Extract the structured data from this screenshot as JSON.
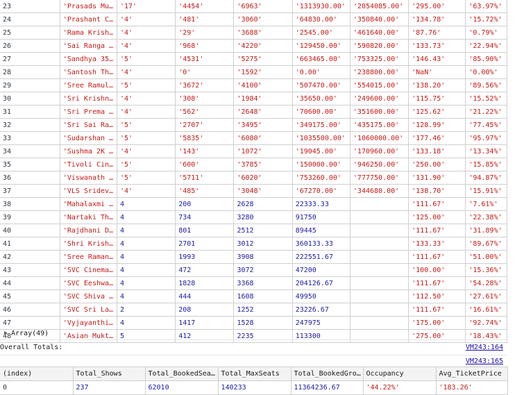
{
  "top_rows": [
    [
      "23",
      "'Prasads Mu…",
      "'17'",
      "'4454'",
      "'6963'",
      "'1313930.00'",
      "'2054085.00'",
      "'295.00'",
      "'63.97%'"
    ],
    [
      "24",
      "'Prashant C…",
      "'4'",
      "'481'",
      "'3060'",
      "'64830.00'",
      "'350840.00'",
      "'134.78'",
      "'15.72%'"
    ],
    [
      "25",
      "'Rama Krish…",
      "'4'",
      "'29'",
      "'3688'",
      "'2545.00'",
      "'461640.00'",
      "'87.76'",
      "'0.79%'"
    ],
    [
      "26",
      "'Sai Ranga …",
      "'4'",
      "'968'",
      "'4220'",
      "'129450.00'",
      "'590820.00'",
      "'133.73'",
      "'22.94%'"
    ],
    [
      "27",
      "'Sandhya 35…",
      "'5'",
      "'4531'",
      "'5275'",
      "'663465.00'",
      "'753325.00'",
      "'146.43'",
      "'85.90%'"
    ],
    [
      "28",
      "'Santosh Th…",
      "'4'",
      "'0'",
      "'1592'",
      "'0.00'",
      "'238800.00'",
      "'NaN'",
      "'0.00%'"
    ],
    [
      "29",
      "'Sree Ramul…",
      "'5'",
      "'3672'",
      "'4100'",
      "'507470.00'",
      "'554015.00'",
      "'138.20'",
      "'89.56%'"
    ],
    [
      "30",
      "'Sri Krishn…",
      "'4'",
      "'308'",
      "'1984'",
      "'35650.00'",
      "'249600.00'",
      "'115.75'",
      "'15.52%'"
    ],
    [
      "31",
      "'Sri Prema …",
      "'4'",
      "'562'",
      "'2648'",
      "'70600.00'",
      "'351600.00'",
      "'125.62'",
      "'21.22%'"
    ],
    [
      "32",
      "'Sri Sai Ra…",
      "'5'",
      "'2707'",
      "'3495'",
      "'349175.00'",
      "'435175.00'",
      "'128.99'",
      "'77.45%'"
    ],
    [
      "33",
      "'Sudarshan …",
      "'5'",
      "'5835'",
      "'6080'",
      "'1035500.00'",
      "'1060000.00'",
      "'177.46'",
      "'95.97%'"
    ],
    [
      "34",
      "'Sushma 2K …",
      "'4'",
      "'143'",
      "'1072'",
      "'19045.00'",
      "'170960.00'",
      "'133.18'",
      "'13.34%'"
    ],
    [
      "35",
      "'Tivoli Cin…",
      "'5'",
      "'600'",
      "'3785'",
      "'150000.00'",
      "'946250.00'",
      "'250.00'",
      "'15.85%'"
    ],
    [
      "36",
      "'Viswanath …",
      "'5'",
      "'5711'",
      "'6020'",
      "'753260.00'",
      "'777750.00'",
      "'131.90'",
      "'94.87%'"
    ],
    [
      "37",
      "'VLS Sridev…",
      "'4'",
      "'485'",
      "'3048'",
      "'67270.00'",
      "'344680.00'",
      "'138.70'",
      "'15.91%'"
    ],
    [
      "38",
      "'Mahalaxmi …",
      "4",
      "200",
      "2628",
      "22333.33",
      "",
      "'111.67'",
      "'7.61%'"
    ],
    [
      "39",
      "'Nartaki Th…",
      "4",
      "734",
      "3280",
      "91750",
      "",
      "'125.00'",
      "'22.38%'"
    ],
    [
      "40",
      "'Rajdhani D…",
      "4",
      "801",
      "2512",
      "89445",
      "",
      "'111.67'",
      "'31.89%'"
    ],
    [
      "41",
      "'Shri Krish…",
      "4",
      "2701",
      "3012",
      "360133.33",
      "",
      "'133.33'",
      "'89.67%'"
    ],
    [
      "42",
      "'Sree Raman…",
      "4",
      "1993",
      "3908",
      "222551.67",
      "",
      "'111.67'",
      "'51.00%'"
    ],
    [
      "43",
      "'SVC Cinema…",
      "4",
      "472",
      "3072",
      "47200",
      "",
      "'100.00'",
      "'15.36%'"
    ],
    [
      "44",
      "'SVC Eeshwa…",
      "4",
      "1828",
      "3368",
      "204126.67",
      "",
      "'111.67'",
      "'54.28%'"
    ],
    [
      "45",
      "'SVC Shiva …",
      "4",
      "444",
      "1608",
      "49950",
      "",
      "'112.50'",
      "'27.61%'"
    ],
    [
      "46",
      "'SVC Sri La…",
      "2",
      "208",
      "1252",
      "23226.67",
      "",
      "'111.67'",
      "'16.61%'"
    ],
    [
      "47",
      "'Vyjayanthi…",
      "4",
      "1417",
      "1528",
      "247975",
      "",
      "'175.00'",
      "'92.74%'"
    ],
    [
      "48",
      "'Asian Mukt…",
      "5",
      "412",
      "2235",
      "113300",
      "",
      "'275.00'",
      "'18.43%'"
    ]
  ],
  "array_label": "Array(49)",
  "totals_label": "Overall Totals:",
  "source_link_1": "VM243:164",
  "source_link_2": "VM243:165",
  "totals_table": {
    "headers": [
      "(index)",
      "Total_Shows",
      "Total_BookedSea…",
      "Total_MaxSeats",
      "Total_BookedGro…",
      "Occupancy",
      "Avg_TicketPrice"
    ],
    "row": [
      "0",
      "237",
      "62010",
      "140233",
      "11364236.67",
      "'44.22%'",
      "'183.26'"
    ]
  },
  "colors": {
    "string": "#c41a16",
    "number": "#1a1aa6",
    "link": "#1a0dab"
  }
}
